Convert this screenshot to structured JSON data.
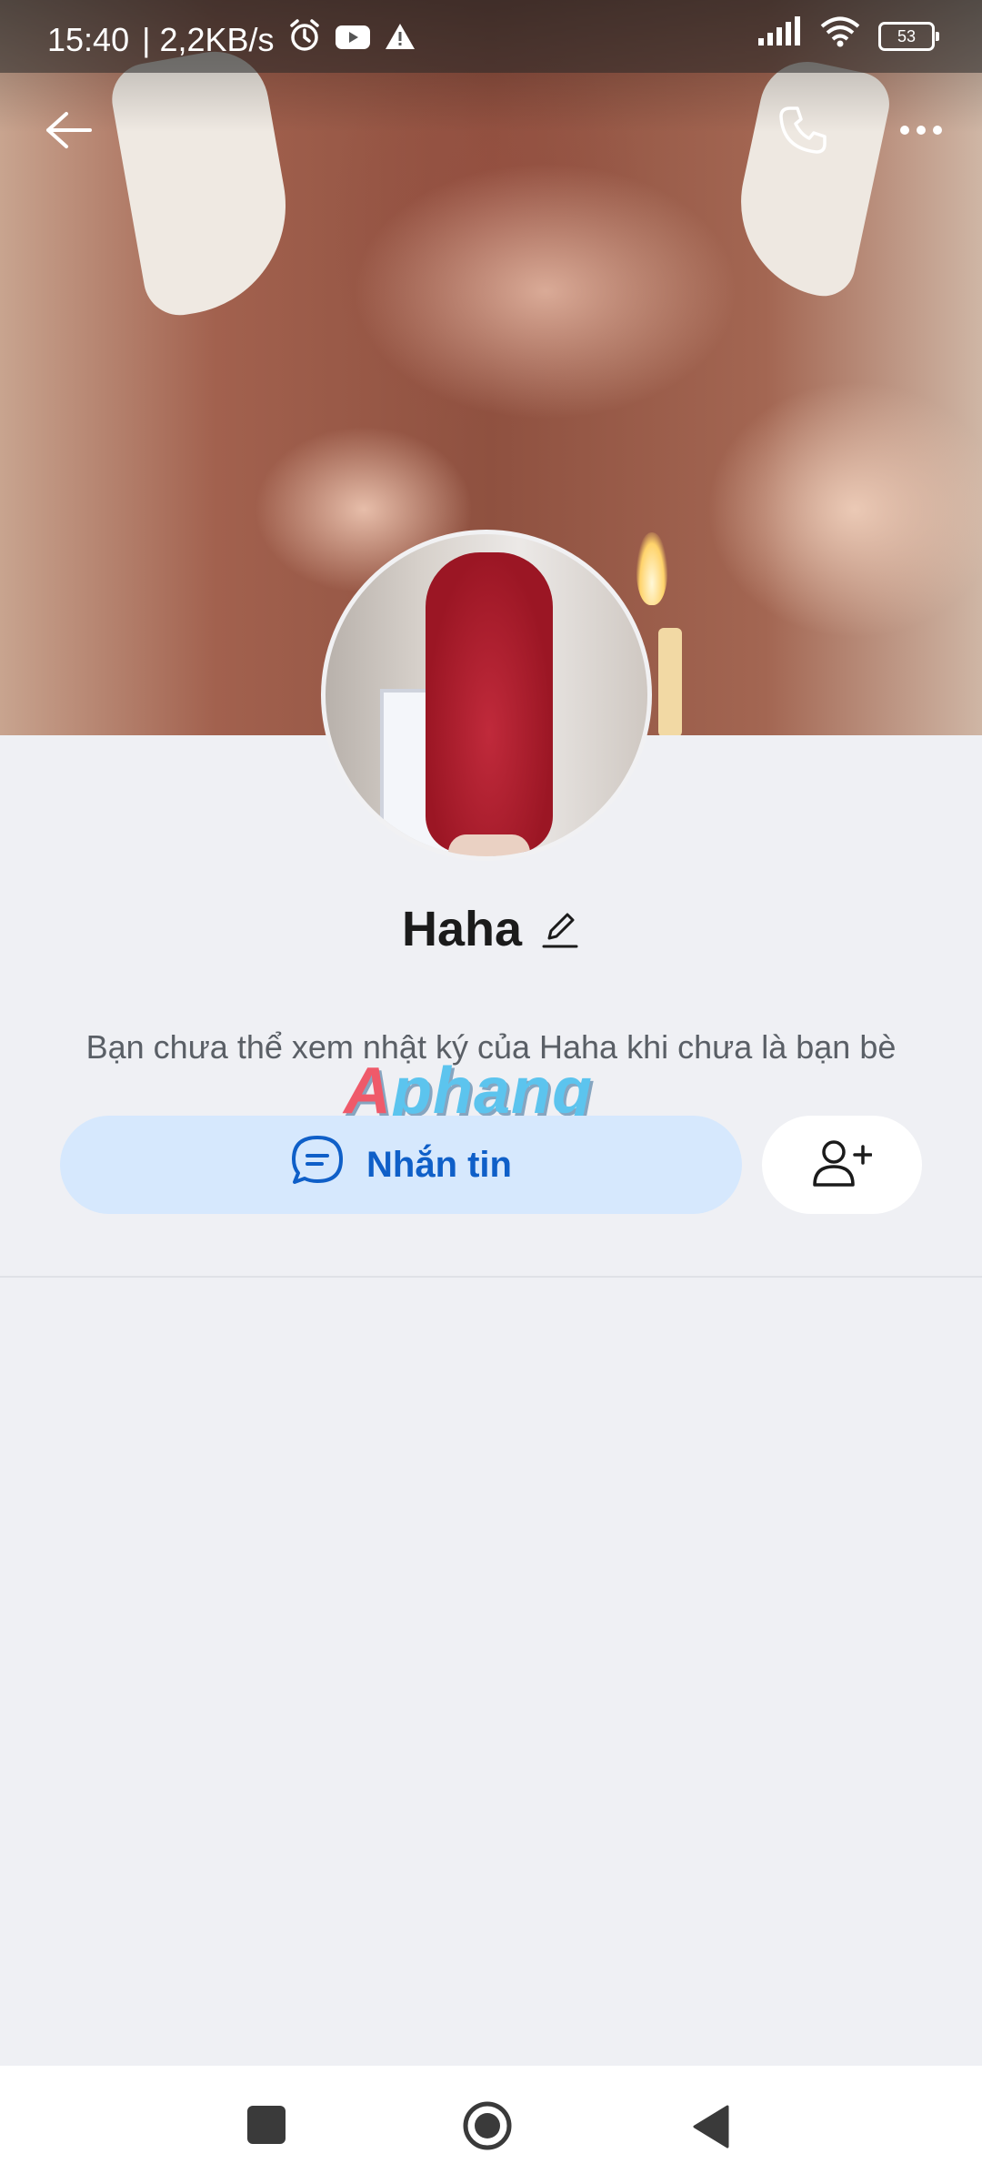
{
  "status_bar": {
    "time": "15:40",
    "network_speed": "| 2,2KB/s",
    "battery": "53",
    "icons": [
      "alarm-icon",
      "youtube-icon",
      "warning-icon",
      "signal-icon",
      "wifi-icon",
      "battery-icon"
    ]
  },
  "header": {
    "back_icon": "back-arrow-icon",
    "call_icon": "phone-icon",
    "more_icon": "more-dots-icon"
  },
  "profile": {
    "name": "Haha",
    "edit_icon": "pencil-icon",
    "notice": "Bạn chưa thể xem nhật ký của Haha khi chưa là bạn bè"
  },
  "watermark": {
    "first": "A",
    "rest": "phang"
  },
  "actions": {
    "message_label": "Nhắn tin",
    "message_icon": "chat-bubble-icon",
    "add_friend_icon": "add-friend-icon"
  },
  "colors": {
    "accent": "#0f5fc8",
    "button_bg": "#d6e8fd",
    "page_bg": "#eff0f4"
  }
}
